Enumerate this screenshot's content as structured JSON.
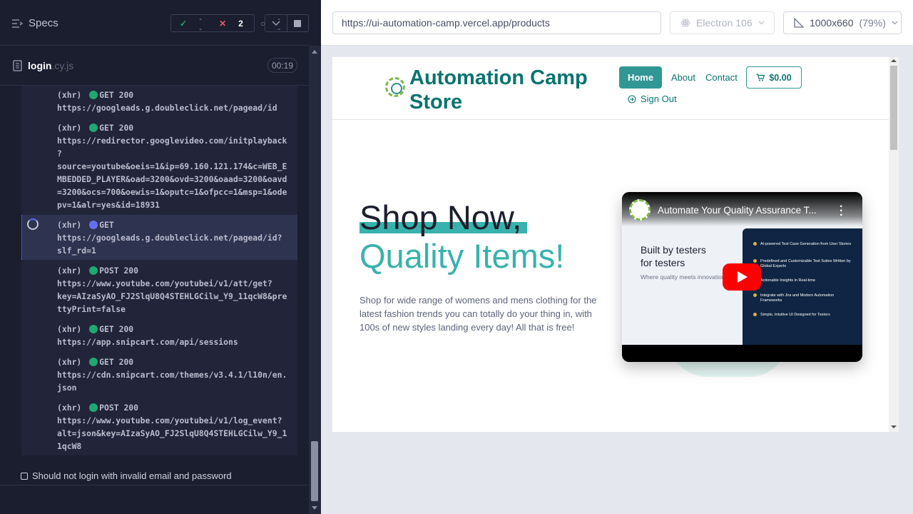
{
  "reporter": {
    "specs_label": "Specs",
    "stats": {
      "passed": "--",
      "failed": "2",
      "pending": "--"
    },
    "file": {
      "name": "login",
      "ext": ".cy.js",
      "time": "00:19"
    },
    "log": [
      {
        "type": "(xhr)",
        "method": "GET 200",
        "status": "success",
        "lines": [
          "https://googleads.g.doubleclick.net/pagead/id"
        ]
      },
      {
        "type": "(xhr)",
        "method": "GET 200",
        "status": "success",
        "lines": [
          "https://redirector.googlevideo.com/initplayback",
          "?",
          "source=youtube&oeis=1&ip=69.160.121.174&c=WEB_E",
          "MBEDDED_PLAYER&oad=3200&ovd=3200&oaad=3200&oavd",
          "=3200&ocs=700&oewis=1&oputc=1&ofpcc=1&msp=1&ode",
          "pv=1&alr=yes&id=18931"
        ]
      },
      {
        "type": "(xhr)",
        "method": "GET",
        "status": "pending",
        "lines": [
          "https://googleads.g.doubleclick.net/pagead/id?",
          "slf_rd=1"
        ]
      },
      {
        "type": "(xhr)",
        "method": "POST 200",
        "status": "success",
        "lines": [
          "https://www.youtube.com/youtubei/v1/att/get?",
          "key=AIzaSyAO_FJ2SlqU8Q4STEHLGCilw_Y9_11qcW8&pre",
          "ttyPrint=false"
        ]
      },
      {
        "type": "(xhr)",
        "method": "GET 200",
        "status": "success",
        "lines": [
          "https://app.snipcart.com/api/sessions"
        ]
      },
      {
        "type": "(xhr)",
        "method": "GET 200",
        "status": "success",
        "lines": [
          "https://cdn.snipcart.com/themes/v3.4.1/l10n/en.",
          "json"
        ]
      },
      {
        "type": "(xhr)",
        "method": "POST 200",
        "status": "success",
        "lines": [
          "https://www.youtube.com/youtubei/v1/log_event?",
          "alt=json&key=AIzaSyAO_FJ2SlqU8Q4STEHLGCilw_Y9_1",
          "1qcW8"
        ]
      }
    ],
    "test_title": "Should not login with invalid email and password"
  },
  "aut": {
    "url": "https://ui-automation-camp.vercel.app/products",
    "browser": "Electron 106",
    "viewport": "1000x660",
    "zoom": "(79%)"
  },
  "site": {
    "brand": "Automation Camp Store",
    "nav": {
      "home": "Home",
      "about": "About",
      "contact": "Contact",
      "cart": "$0.00",
      "signout": "Sign Out"
    },
    "hero_line1": "Shop Now,",
    "hero_line2": "Quality Items!",
    "description": "Shop for wide range of womens and mens clothing for the latest fashion trends you can totally do your thing in, with 100s of new styles landing every day! All that is free!",
    "video": {
      "title": "Automate Your Quality Assurance T...",
      "built_line1": "Built by testers",
      "built_line2": "for testers",
      "subtitle": "Where quality meets innovation",
      "features": [
        "AI-powered Test Case Generation from User Stories",
        "Predefined and Customizable Test Suites Written by Global Experts",
        "Actionable Insights in Real-time",
        "Integrate with Jira and Modern Automation Frameworks",
        "Simple, Intuitive UI Designed for Testers"
      ]
    }
  },
  "colors": {
    "teal": "#319795",
    "teal_dark": "#0b7470",
    "reporter_bg": "#1b1e2e",
    "pass": "#1fa971",
    "fail": "#e45770"
  }
}
